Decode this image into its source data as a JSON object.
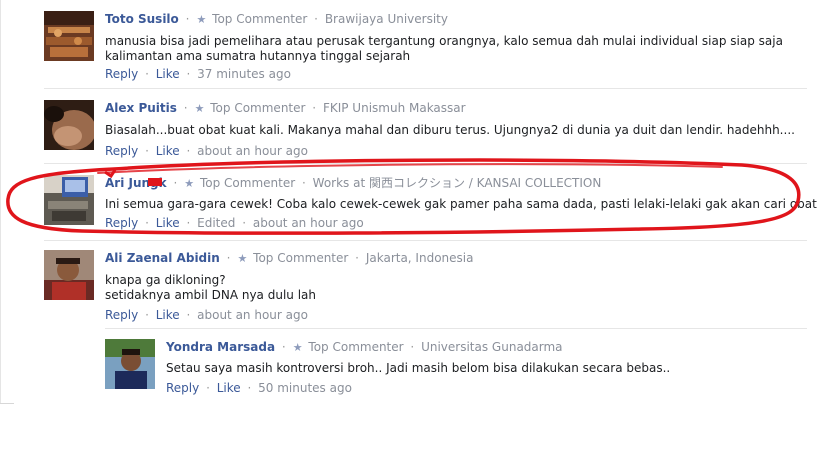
{
  "comments": [
    {
      "author": "Toto Susilo",
      "badge": "Top Commenter",
      "affiliation": "Brawijaya University",
      "text": "manusia bisa jadi pemelihara atau perusak tergantung orangnya, kalo semua dah mulai individual siap siap saja kalimantan ama sumatra hutannya tinggal sejarah",
      "reply": "Reply",
      "like": "Like",
      "time": "37 minutes ago"
    },
    {
      "author": "Alex Puitis",
      "badge": "Top Commenter",
      "affiliation": "FKIP Unismuh Makassar",
      "text": "Biasalah...buat obat kuat kali. Makanya mahal dan diburu terus. Ujungnya2 di dunia ya duit dan lendir. hadehhh....",
      "reply": "Reply",
      "like": "Like",
      "time": "about an hour ago"
    },
    {
      "author": "Ari Jungk",
      "badge": "Top Commenter",
      "affiliation": "Works at 関西コレクション / KANSAI COLLECTION",
      "text": "Ini semua gara-gara cewek! Coba kalo cewek-cewek gak pamer paha sama dada, pasti lelaki-lelaki gak akan cari obat kuat.",
      "reply": "Reply",
      "like": "Like",
      "edited": "Edited",
      "time": "about an hour ago"
    },
    {
      "author": "Ali Zaenal Abidin",
      "badge": "Top Commenter",
      "affiliation": "Jakarta, Indonesia",
      "text_line1": "knapa ga dikloning?",
      "text_line2": "setidaknya ambil DNA nya dulu lah",
      "reply": "Reply",
      "like": "Like",
      "time": "about an hour ago"
    }
  ],
  "reply_comment": {
    "author": "Yondra Marsada",
    "badge": "Top Commenter",
    "affiliation": "Universitas Gunadarma",
    "text": "Setau saya masih kontroversi broh.. Jadi masih belom bisa dilakukan secara bebas..",
    "reply": "Reply",
    "like": "Like",
    "time": "50 minutes ago"
  },
  "colors": {
    "link": "#3b5998",
    "meta": "#8a8f99",
    "highlight": "#e0151b"
  },
  "icons": [
    "star-icon"
  ]
}
